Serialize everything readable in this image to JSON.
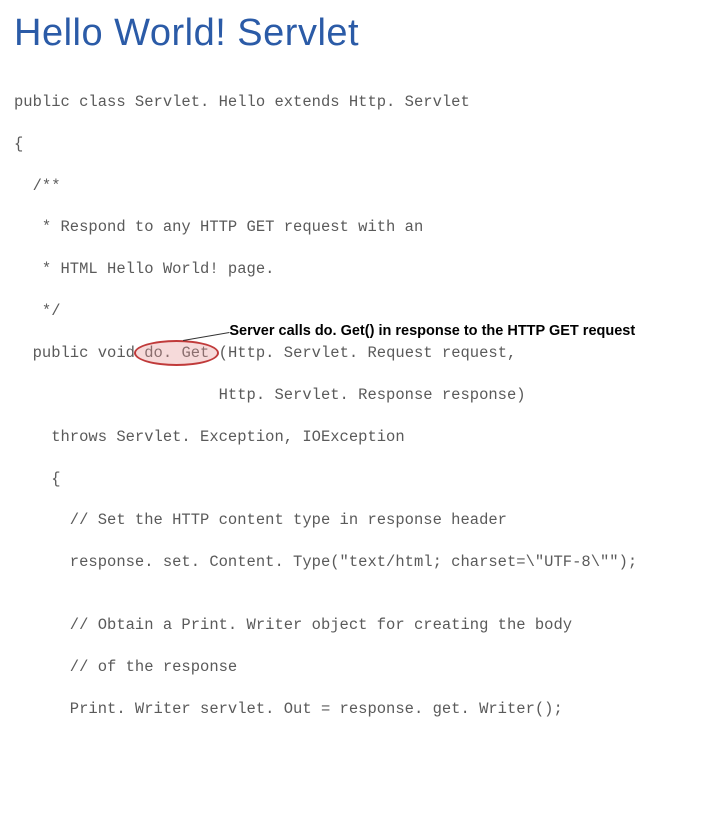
{
  "title": "Hello World! Servlet",
  "code": {
    "l0": "public class Servlet. Hello extends Http. Servlet",
    "l1": "{",
    "l2": "  /**",
    "l3": "   * Respond to any HTTP GET request with an",
    "l4": "   * HTML Hello World! page.",
    "l5": "   */",
    "l6a": "  public void ",
    "l6b": "do. Get",
    "l6c": " (Http. Servlet. Request request,",
    "l7": "                      Http. Servlet. Response response)",
    "l8": "    throws Servlet. Exception, IOException",
    "l9": "    {",
    "l10": "      // Set the HTTP content type in response header",
    "l11": "      response. set. Content. Type(\"text/html; charset=\\\"UTF-8\\\"\");",
    "l12": "",
    "l13": "      // Obtain a Print. Writer object for creating the body",
    "l14": "      // of the response",
    "l15": "      Print. Writer servlet. Out = response. get. Writer();"
  },
  "callout": {
    "text": "Server calls do. Get() in response to the HTTP GET request"
  }
}
